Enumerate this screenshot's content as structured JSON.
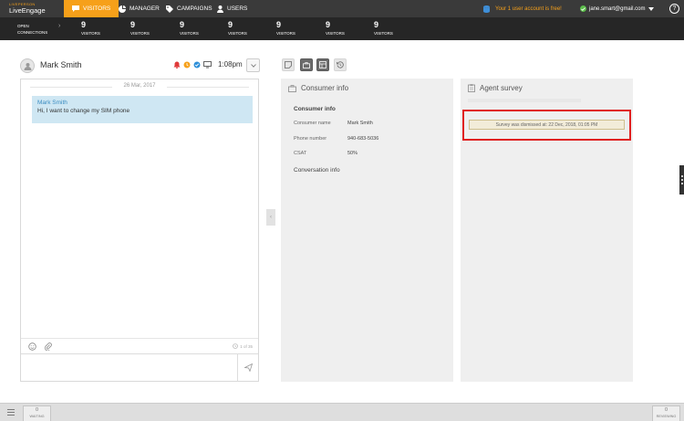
{
  "brand": {
    "sub": "LIVEPERSON",
    "name": "LiveEngage"
  },
  "nav": {
    "tabs": [
      {
        "label": "VISITORS",
        "icon": "chat-icon"
      },
      {
        "label": "MANAGER",
        "icon": "pie-chart-icon"
      },
      {
        "label": "CAMPAIGNS",
        "icon": "tag-icon"
      },
      {
        "label": "USERS",
        "icon": "user-icon"
      }
    ],
    "notice": "Your 1 user account is free!",
    "account_email": "jane.smart@gmail.com",
    "help_label": "?",
    "colors": {
      "accent": "#f6a01a",
      "nav_bg": "#3a3a3a"
    }
  },
  "stats": {
    "open_line1": "OPEN",
    "open_line2": "CONNECTIONS",
    "chevron": "›",
    "items": [
      {
        "count": "9",
        "label": "VISITORS"
      },
      {
        "count": "9",
        "label": "VISITORS"
      },
      {
        "count": "9",
        "label": "VISITORS"
      },
      {
        "count": "9",
        "label": "VISITORS"
      },
      {
        "count": "9",
        "label": "VISITORS"
      },
      {
        "count": "9",
        "label": "VISITORS"
      },
      {
        "count": "9",
        "label": "VISITORS"
      }
    ]
  },
  "chat": {
    "visitor_name": "Mark Smith",
    "time": "1:08pm",
    "date": "26 Mar, 2017",
    "messages": [
      {
        "sender": "Mark Smith",
        "text": "Hi, I want to change my SIM phone"
      }
    ],
    "counter": "1 of 35"
  },
  "collapse_handle": "‹",
  "consumer_info": {
    "title": "Consumer info",
    "section": "Consumer info",
    "fields": [
      {
        "label": "Consumer name",
        "value": "Mark Smith"
      },
      {
        "label": "Phone number",
        "value": "940-683-5036"
      },
      {
        "label": "CSAT",
        "value": "50%"
      }
    ],
    "conversation_section": "Conversation info"
  },
  "agent_survey": {
    "title": "Agent survey",
    "message": "Survey was dismissed at: 22 Dec, 2018, 01:05 PM",
    "highlight_color": "#e02020"
  },
  "bottom": {
    "waiting": {
      "count": "0",
      "label": "WAITING"
    },
    "reviewing": {
      "count": "0",
      "label": "REVIEWING"
    }
  }
}
